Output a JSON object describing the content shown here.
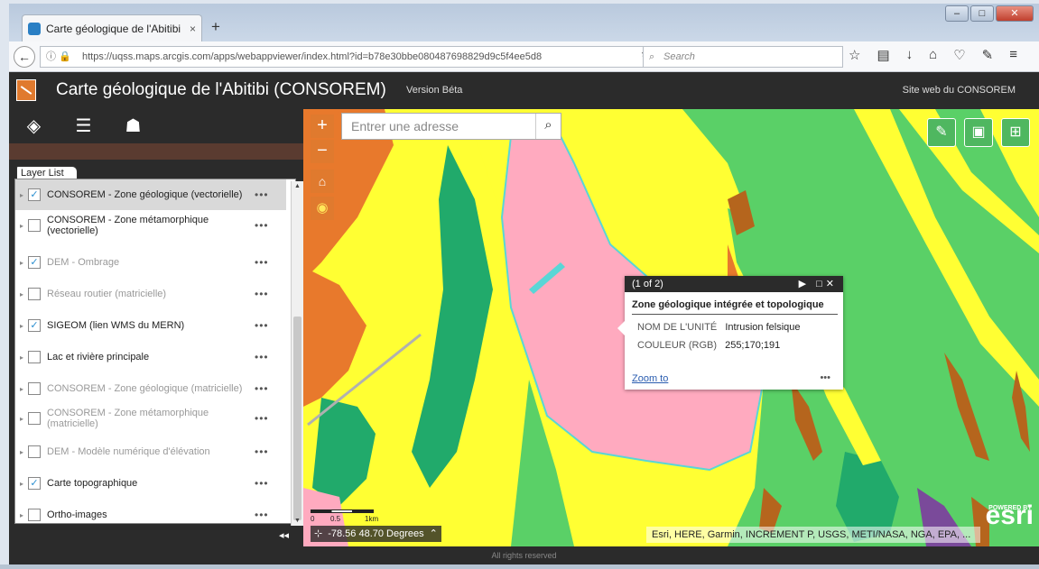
{
  "browser": {
    "tab_title": "Carte géologique de l'Abitibi",
    "tab_close": "×",
    "new_tab": "+",
    "url": "https://uqss.maps.arcgis.com/apps/webappviewer/index.html?id=b78e30bbe080487698829d9c5f4ee5d8",
    "search_placeholder": "Search",
    "window_buttons": [
      "–",
      "□",
      "✕"
    ]
  },
  "app": {
    "title": "Carte géologique de l'Abitibi (CONSOREM)",
    "version": "Version Béta",
    "site_link": "Site web du CONSOREM"
  },
  "panel": {
    "tab_label": "Layer List",
    "layers": [
      {
        "label": "CONSOREM - Zone géologique (vectorielle)",
        "checked": true,
        "selected": true,
        "dim": false
      },
      {
        "label": "CONSOREM - Zone métamorphique (vectorielle)",
        "checked": false,
        "selected": false,
        "dim": false
      },
      {
        "label": "DEM - Ombrage",
        "checked": true,
        "selected": false,
        "dim": true
      },
      {
        "label": "Réseau routier (matricielle)",
        "checked": false,
        "selected": false,
        "dim": true
      },
      {
        "label": "SIGEOM (lien WMS du MERN)",
        "checked": true,
        "selected": false,
        "dim": false
      },
      {
        "label": "Lac et rivière principale",
        "checked": false,
        "selected": false,
        "dim": false
      },
      {
        "label": "CONSOREM - Zone géologique (matricielle)",
        "checked": false,
        "selected": false,
        "dim": true
      },
      {
        "label": "CONSOREM - Zone métamorphique (matricielle)",
        "checked": false,
        "selected": false,
        "dim": true
      },
      {
        "label": "DEM - Modèle numérique d'élévation",
        "checked": false,
        "selected": false,
        "dim": true
      },
      {
        "label": "Carte topographique",
        "checked": true,
        "selected": false,
        "dim": false
      },
      {
        "label": "Ortho-images",
        "checked": false,
        "selected": false,
        "dim": false
      }
    ],
    "dots": "•••",
    "collapse": "◂◂"
  },
  "map": {
    "search_placeholder": "Entrer une adresse",
    "zoom_in": "+",
    "zoom_out": "−",
    "popup": {
      "counter": "(1 of 2)",
      "title": "Zone géologique intégrée et topologique",
      "field1_key": "NOM DE L'UNITÉ",
      "field1_value": "Intrusion felsique",
      "field2_key": "COULEUR (RGB)",
      "field2_value": "255;170;191",
      "zoom_to": "Zoom to",
      "more": "•••"
    },
    "scale_labels": [
      "0",
      "0.5",
      "1km"
    ],
    "coordinates": "-78.56 48.70 Degrees",
    "attribution": "Esri, HERE, Garmin, INCREMENT P, USGS, METI/NASA, NGA, EPA, ...",
    "powered_by": "POWERED BY",
    "esri": "esri"
  },
  "footer": "All rights reserved",
  "colors": {
    "accent": "#e07a2e",
    "header": "#2b2b2b",
    "felsic_pink": "#ffaabf",
    "green": "#5ad067",
    "yellow": "#ffff33"
  }
}
